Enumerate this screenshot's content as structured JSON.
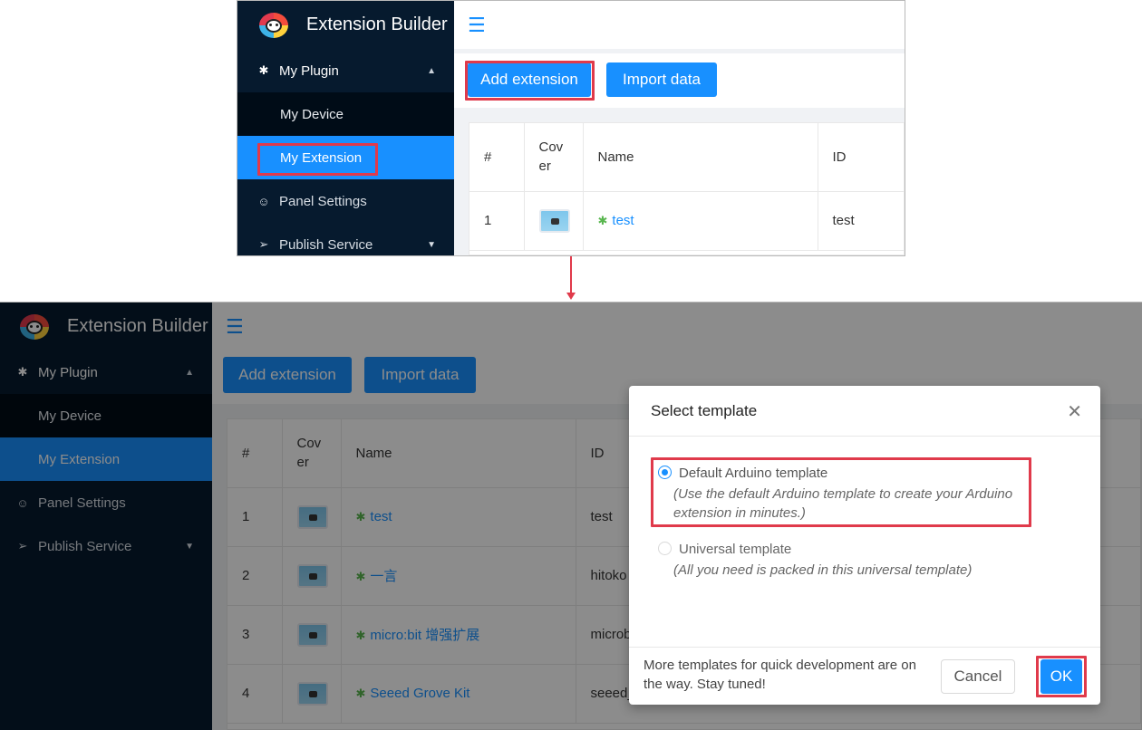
{
  "app": {
    "title": "Extension Builder"
  },
  "sidebar": {
    "group": "My Plugin",
    "sub_items": [
      "My Device",
      "My Extension"
    ],
    "items": [
      "Panel Settings",
      "Publish Service"
    ]
  },
  "toolbar": {
    "add_label": "Add extension",
    "import_label": "Import data"
  },
  "table": {
    "headers": {
      "num": "#",
      "cover": "Cov er",
      "name": "Name",
      "id": "ID"
    },
    "rows": [
      {
        "num": "1",
        "name": "test",
        "id": "test"
      },
      {
        "num": "2",
        "name": "一言",
        "id": "hitoko"
      },
      {
        "num": "3",
        "name": "micro:bit 增强扩展",
        "id": "microb"
      },
      {
        "num": "4",
        "name": "Seeed Grove Kit",
        "id": "seeed_"
      }
    ]
  },
  "modal": {
    "title": "Select template",
    "options": [
      {
        "label": "Default Arduino template",
        "desc": "(Use the default Arduino template to create your Arduino extension in minutes.)",
        "checked": true
      },
      {
        "label": "Universal template",
        "desc": "(All you need is packed in this universal template)",
        "checked": false
      }
    ],
    "footer_note": "More templates for quick development are on the way. Stay tuned!",
    "cancel_label": "Cancel",
    "ok_label": "OK"
  },
  "colors": {
    "primary": "#1890ff",
    "sidebar": "#061a2e",
    "highlight": "#e03a4b"
  }
}
